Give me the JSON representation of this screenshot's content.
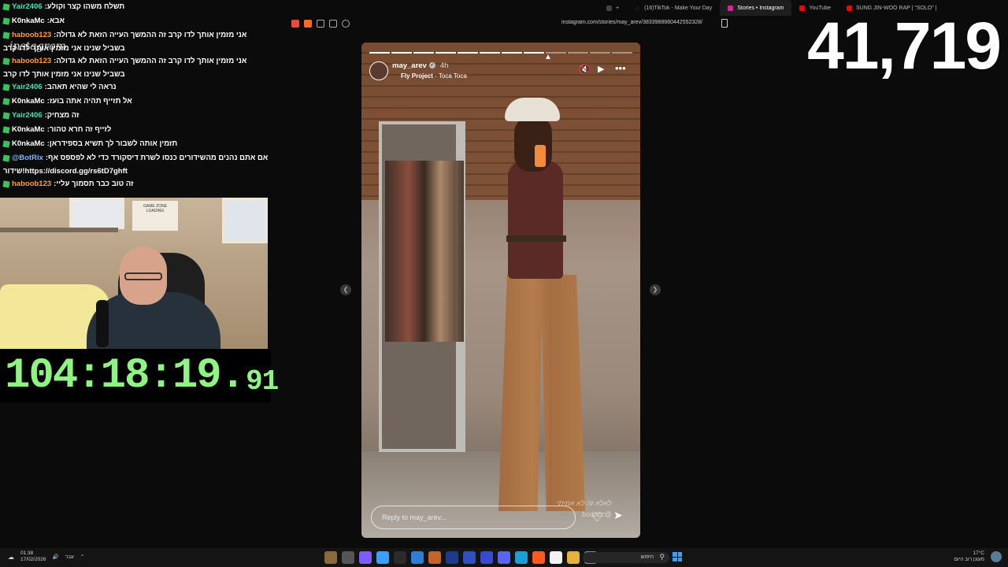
{
  "browser": {
    "tabs": [
      {
        "label": "+",
        "color": "#444444"
      },
      {
        "label": "(16)TikTok - Make Your Day",
        "color": "#111111"
      },
      {
        "label": "Stories • Instagram",
        "color": "#d6249f",
        "active": true
      },
      {
        "label": "YouTube",
        "color": "#ff0000"
      },
      {
        "label": "SUNG JIN-WOO RAP | \"SOLO\" |",
        "color": "#ff0000"
      }
    ],
    "url": "instagram.com/stories/may_arev/3833988660442552328/"
  },
  "chat": {
    "logo_text": "instagram",
    "messages": [
      {
        "user": "Yair2406",
        "user_color": "#3ee6c0",
        "text": "תשלח משהו קצר וקולע"
      },
      {
        "user": "K0nkaMc",
        "user_color": "#ffffff",
        "text": "אבא"
      },
      {
        "user": "haboob123",
        "user_color": "#ff9e3b",
        "text": "אני מזמין אותך לדו קרב זה ההמשך העייה הזאת לא גדולה"
      },
      {
        "wrap": "בשביל שנינו אני מזמין אותך לדו קרב"
      },
      {
        "user": "haboob123",
        "user_color": "#ff9e3b",
        "text": "אני מזמין אותך לדו קרב זה ההמשך העייה הזאת לא גדולה"
      },
      {
        "wrap": "בשביל שנינו אני מזמין אותך לדו קרב"
      },
      {
        "user": "Yair2406",
        "user_color": "#3ee6c0",
        "text": "נראה לי שהיא תאהב"
      },
      {
        "user": "K0nkaMc",
        "user_color": "#ffffff",
        "text": "אל תזייף תהיה אתה בועז"
      },
      {
        "user": "Yair2406",
        "user_color": "#3ee6c0",
        "text": "זה מצחיק"
      },
      {
        "user": "K0nkaMc",
        "user_color": "#ffffff",
        "text": "לזייף זה חרא טהור"
      },
      {
        "user": "K0nkaMc",
        "user_color": "#ffffff",
        "text": "תזמין אותה לשבור לך תשיא בספידראן"
      },
      {
        "user": "@BotRix",
        "user_color": "#7ab8ff",
        "text": "אם אתם נהנים מהשידורים כנסו לשרת דיסקורד כדי לא לפספס אף"
      },
      {
        "wrap": "שידור!https://discord.gg/rs6tD7ghft"
      },
      {
        "user": "haboob123",
        "user_color": "#ff9e3b",
        "text": "זה טוב כבר תסמוך עליי"
      }
    ]
  },
  "webcam": {
    "poster_text": "GAME ZONE",
    "poster_sub": "LOADING"
  },
  "timer": {
    "main": "104:18:19.",
    "ms": "91"
  },
  "counter": "41,719",
  "story": {
    "username": "may_arev",
    "time": "4h",
    "music_artist": "Fly Project",
    "music_song": "Toca Toca",
    "segments_total": 12,
    "segments_done": 8,
    "reply_placeholder": "Reply to may_arev...",
    "watermark": "לאלא זה לא אמיתי",
    "watermark2": "@boazzz",
    "prev_icon": "chevron-left-icon",
    "next_icon": "chevron-right-icon"
  },
  "taskbar": {
    "time": "01:38",
    "date": "17/02/2026",
    "lang": "עבר",
    "search_label": "חיפוש",
    "weather_temp": "17°C",
    "weather_desc": "מעונן רוב היום"
  }
}
